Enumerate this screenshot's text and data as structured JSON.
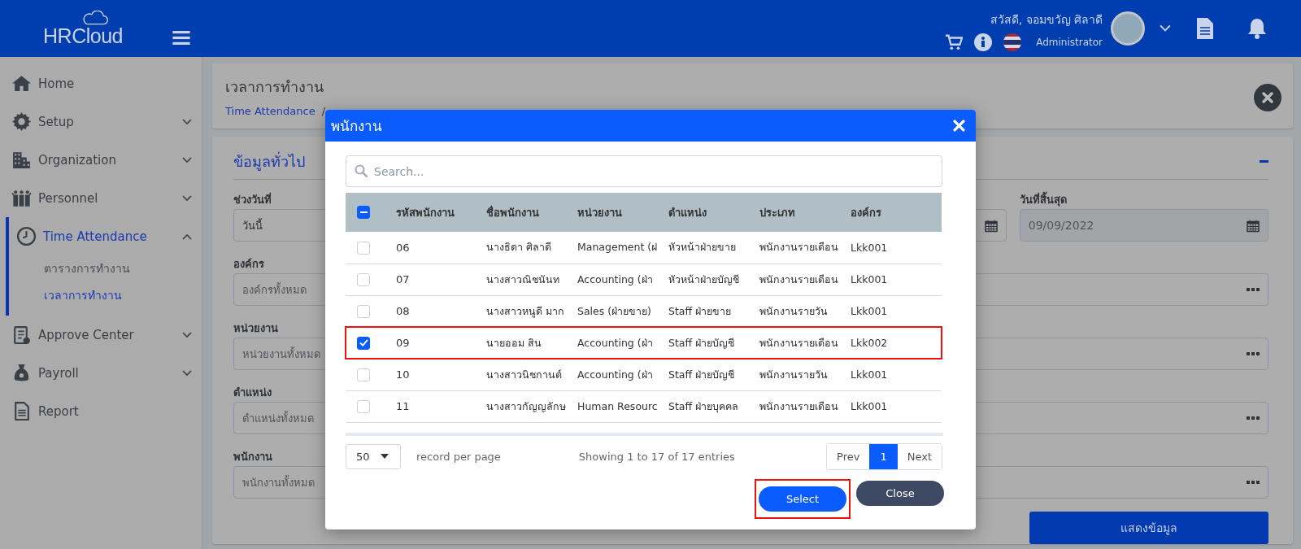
{
  "header": {
    "logo": "HRCloud",
    "greeting": "สวัสดี, จอมขวัญ ศิลาดี",
    "role": "Administrator"
  },
  "sidebar": {
    "items": [
      {
        "label": "Home",
        "selected": false
      },
      {
        "label": "Setup",
        "selected": false,
        "expanded": false
      },
      {
        "label": "Organization",
        "selected": false,
        "expanded": false
      },
      {
        "label": "Personnel",
        "selected": false,
        "expanded": false
      },
      {
        "label": "Time Attendance",
        "selected": true,
        "expanded": true,
        "children": [
          {
            "label": "ตารางการทำงาน",
            "selected": false
          },
          {
            "label": "เวลาการทำงาน",
            "selected": true
          }
        ]
      },
      {
        "label": "Approve Center",
        "selected": false,
        "expanded": false
      },
      {
        "label": "Payroll",
        "selected": false,
        "expanded": false
      },
      {
        "label": "Report",
        "selected": false
      }
    ]
  },
  "page_header": {
    "title": "เวลาการทำงาน",
    "breadcrumb": [
      "Time Attendance",
      "/"
    ]
  },
  "form": {
    "title": "ข้อมูลทั่วไป",
    "date_range": {
      "label": "ช่วงวันที่",
      "value": "วันนี้"
    },
    "end_date": {
      "label": "วันที่สิ้นสุด",
      "value": "09/09/2022",
      "disabled": true
    },
    "lookups": [
      {
        "label": "องค์กร",
        "placeholder": "องค์กรทั้งหมด"
      },
      {
        "label": "หน่วยงาน",
        "placeholder": "หน่วยงานทั้งหมด"
      },
      {
        "label": "ตำแหน่ง",
        "placeholder": "ตำแหน่งทั้งหมด"
      },
      {
        "label": "พนักงาน",
        "placeholder": "พนักงานทั้งหมด"
      }
    ],
    "submit": "แสดงข้อมูล"
  },
  "modal": {
    "title": "พนักงาน",
    "search": {
      "placeholder": "Search..."
    },
    "table": {
      "indeterminate": true,
      "columns": [
        "รหัสพนักงาน",
        "ชื่อพนักงาน",
        "หน่วยงาน",
        "ตำแหน่ง",
        "ประเภท",
        "องค์กร"
      ],
      "rows": [
        {
          "checked": false,
          "highlighted": false,
          "cells": [
            "06",
            "นางธิดา ศิลาดี",
            "Management (ฝ",
            "หัวหน้าฝ่ายขาย",
            "พนักงานรายเดือน",
            "Lkk001"
          ]
        },
        {
          "checked": false,
          "highlighted": false,
          "cells": [
            "07",
            "นางสาวณิชนันท",
            "Accounting (ฝ่า",
            "หัวหน้าฝ่ายบัญชี",
            "พนักงานรายเดือน",
            "Lkk001"
          ]
        },
        {
          "checked": false,
          "highlighted": false,
          "cells": [
            "08",
            "นางสาวหนูดี มาก",
            "Sales (ฝ่ายขาย)",
            "Staff ฝ่ายขาย",
            "พนักงานรายวัน",
            "Lkk001"
          ]
        },
        {
          "checked": true,
          "highlighted": true,
          "cells": [
            "09",
            "นายออม สิน",
            "Accounting (ฝ่า",
            "Staff ฝ่ายบัญชี",
            "พนักงานรายเดือน",
            "Lkk002"
          ]
        },
        {
          "checked": false,
          "highlighted": false,
          "cells": [
            "10",
            "นางสาวนิชกานต์",
            "Accounting (ฝ่า",
            "Staff ฝ่ายบัญชี",
            "พนักงานรายวัน",
            "Lkk001"
          ]
        },
        {
          "checked": false,
          "highlighted": false,
          "cells": [
            "11",
            "นางสาวกัญญลักษ",
            "Human Resourc",
            "Staff ฝ่ายบุคคล",
            "พนักงานรายเดือน",
            "Lkk001"
          ]
        }
      ]
    },
    "page_size": "50",
    "page_size_label": "record per page",
    "summary": "Showing 1 to 17 of 17 entries",
    "pagination": [
      {
        "label": "Prev",
        "selected": false
      },
      {
        "label": "1",
        "selected": true
      },
      {
        "label": "Next",
        "selected": false
      }
    ],
    "buttons": [
      {
        "label": "Select",
        "kind": "primary",
        "highlighted": true
      },
      {
        "label": "Close",
        "kind": "secondary",
        "highlighted": false
      }
    ]
  }
}
